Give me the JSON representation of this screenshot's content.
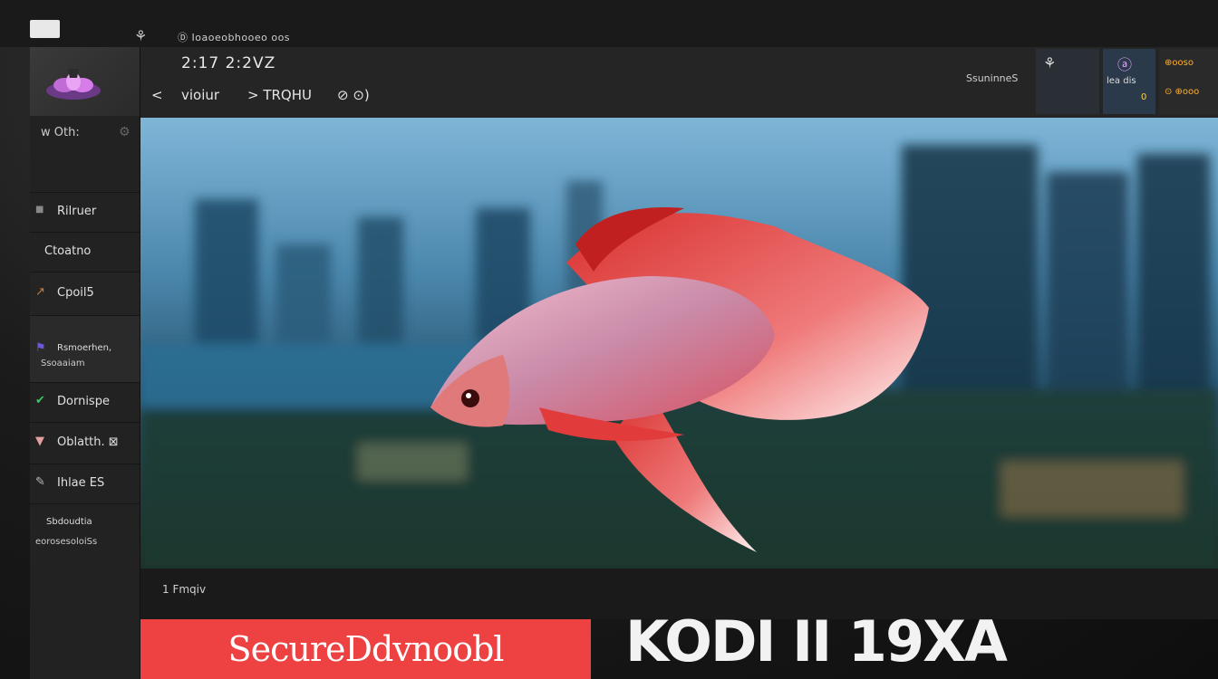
{
  "window": {
    "title_line": "Ⓓ Ioaoeobhooeo oos",
    "small_glyph": "⚘"
  },
  "header": {
    "time": "2:17 2:2VZ",
    "nav_back": "<",
    "nav_item_1": "vioiur",
    "nav_item_2": "> TRQHU",
    "nav_item_3": "⊘ ⊙)",
    "right_label": "SsuninneS",
    "card_1_top": "⚘",
    "card_2_top": "ⓐ",
    "card_2_sub": "lea dis",
    "card_2_badge": "0",
    "card_3_top": "⊕ooso",
    "card_3_bottom": "⊙ ⊕ooo"
  },
  "sidebar": {
    "header_label": "w Oth:",
    "header_icon": "gear-icon",
    "items": [
      {
        "label": "Rilruer",
        "icon": "square-icon"
      },
      {
        "label": "Ctoatno",
        "icon": ""
      },
      {
        "label": "Cpoil5",
        "icon": "leaf-icon"
      },
      {
        "line1": "Rsmoerhen,",
        "line2": "Ssoaaiam",
        "icon": "flag-icon"
      },
      {
        "label": "Dornispe",
        "icon": "check-icon"
      },
      {
        "label": "Oblatth. ⊠",
        "icon": "cup-icon"
      },
      {
        "label": "Ihlae ES",
        "icon": "pen-icon"
      },
      {
        "line1": "Sbdoudtia",
        "line2": "eorosesoloiSs",
        "icon": ""
      }
    ]
  },
  "content": {
    "bottom_label": "1 Fmqiv",
    "cta_label": "SecureDdvnoobl",
    "big_text": "KODI II 19XA"
  },
  "colors": {
    "accent": "#ee4242",
    "fish_red": "#d8312f",
    "sidebar_bg": "#222222"
  }
}
